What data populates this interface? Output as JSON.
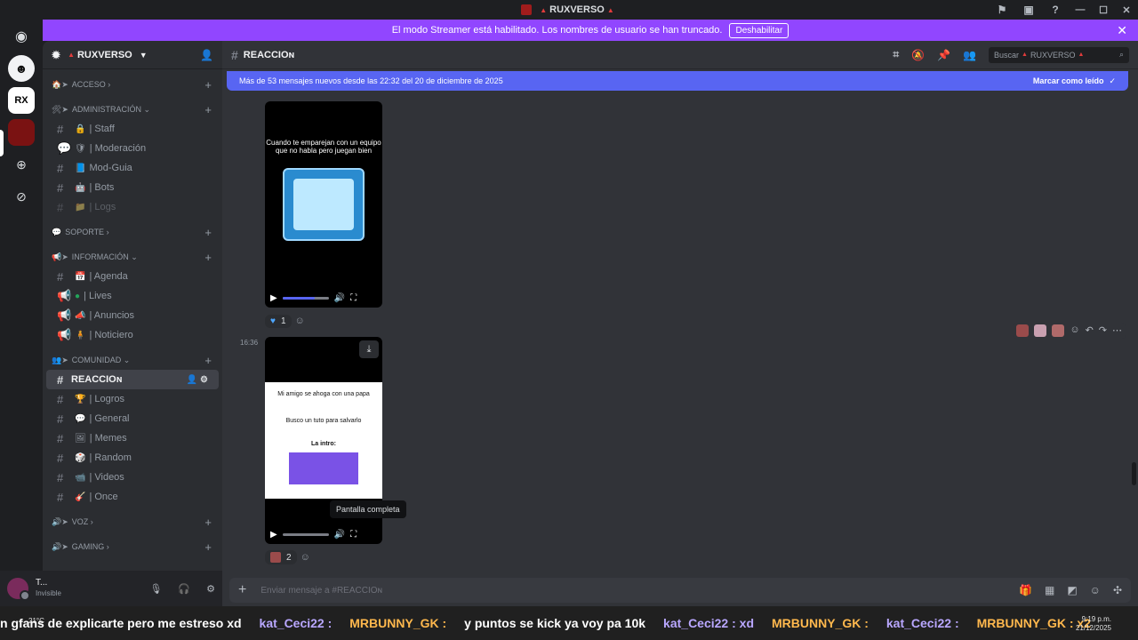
{
  "window": {
    "title": "RUXVERSO"
  },
  "banner": {
    "text": "El modo Streamer está habilitado. Los nombres de usuario se han truncado.",
    "button": "Deshabilitar"
  },
  "server": {
    "name": "RUXVERSO"
  },
  "categories": {
    "acceso": "ACCESO",
    "administracion": "ADMINISTRACIÓN",
    "soporte": "SOPORTE",
    "informacion": "INFORMACIÓN",
    "comunidad": "COMUNIDAD",
    "voz": "VOZ",
    "gaming": "GAMING"
  },
  "channels": {
    "staff": "| Staff",
    "moderacion": "| Moderación",
    "modguia": "Mod-Guia",
    "bots": "| Bots",
    "logs": "| Logs",
    "agenda": "| Agenda",
    "lives": "| Lives",
    "anuncios": "| Anuncios",
    "noticiero": "| Noticiero",
    "reaccion": "REACCIOɴ",
    "logros": "| Logros",
    "general": "| General",
    "memes": "| Memes",
    "random": "| Random",
    "videos": "| Videos",
    "once": "| Once"
  },
  "user": {
    "name": "T...",
    "status": "Invisible"
  },
  "header": {
    "channel": "REACCIOɴ",
    "search_label": "Buscar",
    "search_server": "RUXVERSO"
  },
  "newbar": {
    "text": "Más de 53 mensajes nuevos desde las 22:32 del 20 de diciembre de 2025",
    "mark": "Marcar como leído"
  },
  "video1": {
    "caption": "Cuando te emparejan con un equipo que no habla pero juegan bien",
    "progress": 0.7
  },
  "reaction1": {
    "count": "1"
  },
  "message2": {
    "timestamp": "16:36"
  },
  "video2": {
    "line1": "Mi amigo se ahoga con una papa",
    "line2": "Busco un tuto para salvarlo",
    "line3": "La intro:",
    "progress": 0.0
  },
  "tooltip": {
    "text": "Pantalla completa"
  },
  "reaction2": {
    "count": "2"
  },
  "composer": {
    "placeholder": "Enviar mensaje a #REACCIOɴ"
  },
  "taskbar": {
    "temp": "21°C",
    "ticker": [
      {
        "text": "n gfans de explicarte pero me estreso xd",
        "kind": "msg"
      },
      {
        "text": "kat_Ceci22 :",
        "kind": "name1"
      },
      {
        "text": "MRBUNNY_GK :",
        "kind": "name2"
      },
      {
        "text": "y puntos se kick ya voy pa 10k",
        "kind": "msg"
      },
      {
        "text": "kat_Ceci22 : xd",
        "kind": "name1"
      },
      {
        "text": "MRBUNNY_GK :",
        "kind": "name2"
      },
      {
        "text": "kat_Ceci22 :",
        "kind": "name1"
      },
      {
        "text": "MRBUNNY_GK : x2",
        "kind": "name2"
      }
    ],
    "time": "9:19 p.m.",
    "date": "21/12/2025"
  },
  "colors": {
    "accent": "#5865f2",
    "streamer": "#9146ff",
    "brand_red": "#e23c3c"
  }
}
